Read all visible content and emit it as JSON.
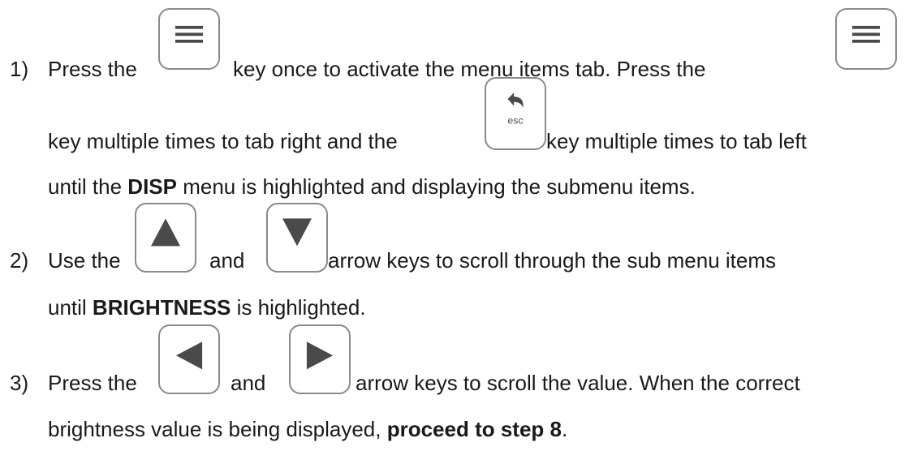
{
  "steps": [
    {
      "number": "1)",
      "l1a": "Press the",
      "l1b": "key once to activate the menu items tab.  Press the",
      "l2a": "key multiple times to tab right and the",
      "l2b": "key multiple times to tab left",
      "l3a": "until the ",
      "l3b": "DISP",
      "l3c": " menu is highlighted and displaying the submenu items."
    },
    {
      "number": "2)",
      "l1a": "Use the",
      "l1b": "and",
      "l1c": "arrow keys to scroll through the sub menu items",
      "l2a": "until ",
      "l2b": "BRIGHTNESS",
      "l2c": " is highlighted."
    },
    {
      "number": "3)",
      "l1a": "Press the",
      "l1b": "and",
      "l1c": "arrow keys to scroll the value.  When the correct",
      "l2a": "brightness value is being displayed, ",
      "l2b": "proceed to step 8",
      "l2c": "."
    }
  ],
  "keys": {
    "menu_icon": "menu-icon",
    "esc_label": "esc",
    "up_icon": "up-arrow-icon",
    "down_icon": "down-arrow-icon",
    "left_icon": "left-arrow-icon",
    "right_icon": "right-arrow-icon"
  },
  "colors": {
    "text": "#1a1a1a",
    "key_border": "#8a8a8a",
    "key_icon": "#4a4a4a"
  }
}
